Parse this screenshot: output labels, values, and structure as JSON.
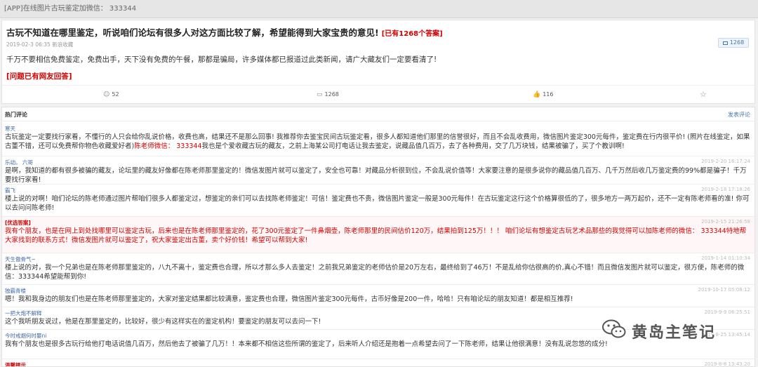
{
  "topbar": {
    "text": "[APP]在线图片古玩鉴定加微信： 333344"
  },
  "question": {
    "title": "古玩不知道在哪里鉴定，听说咱们论坛有很多人对这方面比较了解，希望能得到大家宝贵的意见!",
    "answer_count": "[已有1268个答案]",
    "meta": "2019-02-3 06:35 新浪收藏",
    "reply_count": "1268",
    "body": "千万不要相信免费鉴定，免费出手，天下没有免费的午餐，那都是骗局，许多媒体都已报道过此类新闻，请广大藏友们一定要看清了!",
    "answered": "[问题已有网友回答]",
    "stats": {
      "likes": "52",
      "comments": "1268",
      "thumbs": "116"
    },
    "icons": [
      "like-icon",
      "comment-icon",
      "thumb-icon",
      "star-icon"
    ]
  },
  "comments_section": {
    "title": "热门评论",
    "post_link": "发表评论",
    "items": [
      {
        "user": "寒天",
        "time": "",
        "featured": false,
        "text_a": "古玩鉴定一定要找行家看，不懂行的人只会给你乱说价格，收费也高，结果还不是那么回事! 我推荐你去鉴宝民间古玩鉴定看，很多人都知道他们那里的信誉很好，而且不会乱收费用，微信图片鉴定300元每件，鉴定费在行内很平价! (照片在线鉴定，如果古董不错，还可以免费帮你物色收藏爱好者)",
        "text_hl": "陈老师微信： 333344",
        "text_b": "我也是个爱收藏古玩的藏友，之前上海某公司打电话让我去鉴定，说藏品值几百万，去了各种费用，交了几万块钱，结果被骗了，买了个教训啊!"
      },
      {
        "user": "乐动。 六哥",
        "time": "2019-2-20 16:17:24",
        "featured": false,
        "text": "是啊，我知道的都有很多被骗的藏友，论坛里的藏友好像都在陈老师那里鉴定的！微信发图片就可以鉴定了，安全也可靠！对藏品分析很到位，不会乱说价值等！大家要注意的是很多说你的藏品值几百万、几千万然后收几万鉴定费的99%都是骗子！千万要找行家看!"
      },
      {
        "user": "霸飞",
        "time": "2019-2-18 17:18:26",
        "featured": false,
        "text": "楼上说的对啊！咱们论坛的陈老师通过图片帮咱们很多人都鉴定过，想鉴定的亲们可以去找陈老师鉴定！可信！鉴定费也不贵，微信图片鉴定一般是300元每件！在古玩鉴定这行这个价格算很低的了，很多地方一两万起价，还不一定有陈老师看的准! 你可以去问问陈老师!"
      },
      {
        "user": "[优选答案]",
        "time": "2019-2-15 21:26:58",
        "featured": true,
        "text": "我有个朋友，也是在网上到处找哪里可以鉴定古玩，后来也是在陈老师那里鉴定的，花了300元鉴定了一件鼻烟壶，陈老师那里的民间估价120万，结果拍到125万！！！ 咱们论坛有想鉴定古玩艺术品那些的我觉得可以加陈老师的微信： 333344特地帮大家找到的联系方式！微信发图片就可以鉴定了，祝大家鉴定出古董，卖个好价钱！希望可以帮到大家!"
      },
      {
        "user": "天生傲骨气~",
        "time": "2019-1-14 01:10:34",
        "featured": false,
        "text": "楼上说的对，我一个兄弟也是在陈老师那里鉴定的，八九不离十，鉴定费也合理，所以才那么多人去鉴定！之前我兄弟鉴定的老师估价是20万左右，最终给到了46万！不是乱给你估很高的价,真心不错！而且微信发图片就可以鉴定，很方便，陈老师的微信：333344希望能帮到你!"
      },
      {
        "user": "独霸青楼",
        "time": "2019-10-17 05:08:12",
        "featured": false,
        "text": "嗯！我和我身边的朋友们也是在陈老师那里鉴定的，大家对鉴定结果都比较满意，鉴定费也合理，微信图片鉴定300元每件，古币好像是200一件，哈哈！只有咱论坛的朋友知道！都是相互推荐!"
      },
      {
        "user": "一把大炮不解释",
        "time": "2019-9-9 06:25:51",
        "featured": false,
        "text": "这个我听朋友说过，他是在那里鉴定的，比较好，很少有这样实在的鉴定机构！要鉴定的朋友可以去问一下!"
      },
      {
        "user": "今时戒烟何时娶ni",
        "time": "2019-8-25 13:45:14",
        "featured": false,
        "text": "我有个朋友也是很多古玩行给他打电话说值几百万，然后他去了被骗了几万！！本来都不相信这些所谓的鉴定了，后来听人介绍还是抱着一点希望去问了一下陈老师，结果让他很满意！没有乱说忽悠的成分!"
      },
      {
        "user": "温馨提示",
        "time": "2019-8-8 13:43:20",
        "featured": false,
        "text": ""
      }
    ]
  },
  "watermark": {
    "text": "黄岛主笔记"
  }
}
